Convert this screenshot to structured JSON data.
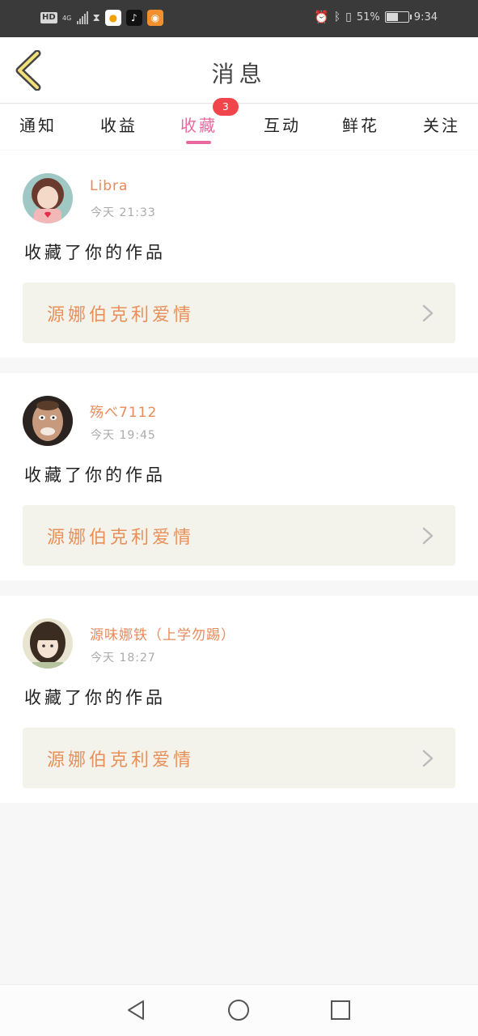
{
  "status_bar": {
    "hd": "HD",
    "network": "4G",
    "battery": "51%",
    "battery_level": 0.51,
    "time": "9:34",
    "icons": [
      "signal-icon",
      "hourglass-icon",
      "app-icon",
      "tiktok-icon",
      "browser-icon",
      "alarm-icon",
      "bluetooth-icon",
      "vibrate-icon",
      "battery-icon"
    ]
  },
  "header": {
    "title": "消息",
    "back_icon": "chevron-left-icon"
  },
  "tabs": [
    {
      "label": "通知",
      "active": false
    },
    {
      "label": "收益",
      "active": false
    },
    {
      "label": "收藏",
      "active": true,
      "badge": "3"
    },
    {
      "label": "互动",
      "active": false
    },
    {
      "label": "鲜花",
      "active": false
    },
    {
      "label": "关注",
      "active": false
    }
  ],
  "colors": {
    "accent": "#e86aa0",
    "badge": "#f0464b",
    "username": "#e88a5a",
    "work_title": "#e8905a",
    "card_link_bg": "#f4f3eb"
  },
  "messages": [
    {
      "username": "Libra",
      "time": "今天 21:33",
      "action": "收藏了你的作品",
      "work_title": "源娜伯克利爱情"
    },
    {
      "username": "殇べ7112",
      "time": "今天 19:45",
      "action": "收藏了你的作品",
      "work_title": "源娜伯克利爱情"
    },
    {
      "username": "源味娜铁（上学勿踢）",
      "time": "今天 18:27",
      "action": "收藏了你的作品",
      "work_title": "源娜伯克利爱情"
    }
  ],
  "nav_bar": {
    "icons": [
      "back-triangle-icon",
      "home-circle-icon",
      "recents-square-icon"
    ]
  }
}
